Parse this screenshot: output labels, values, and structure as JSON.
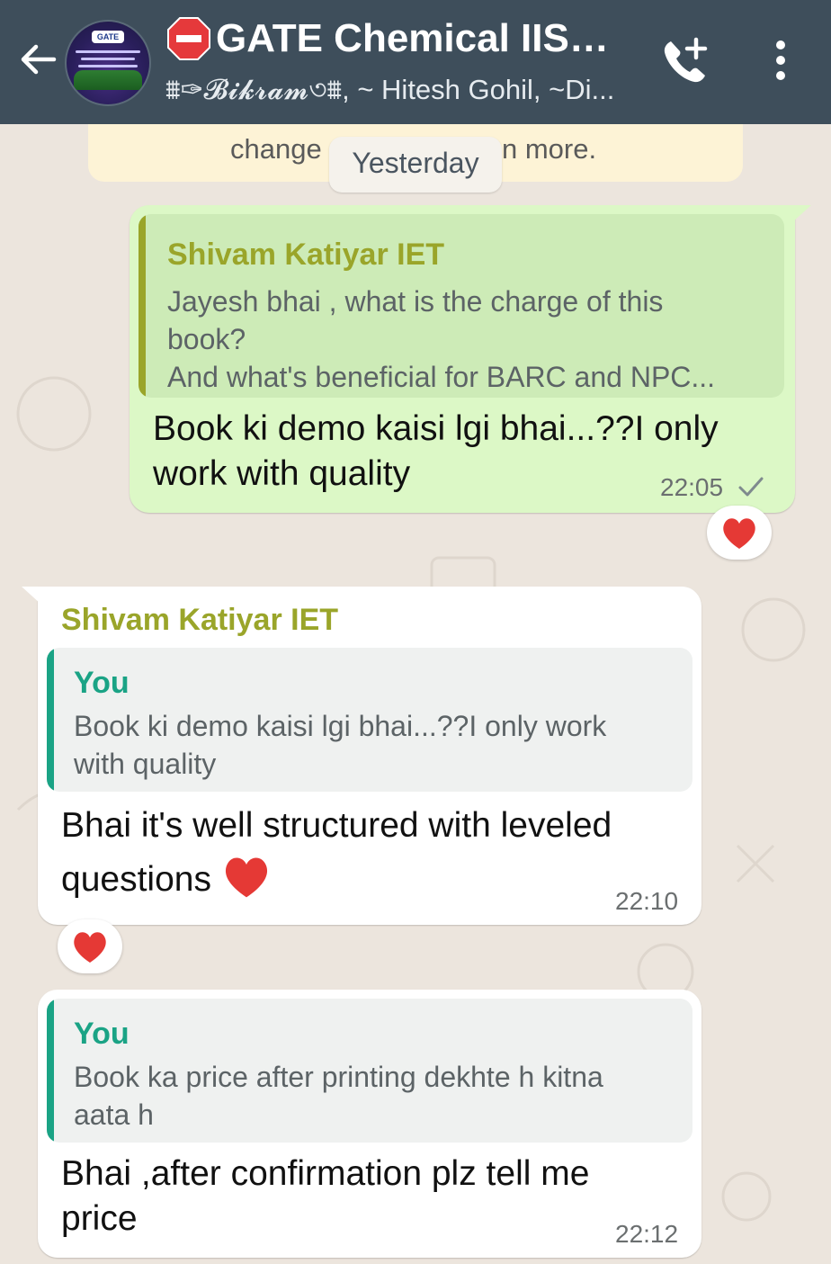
{
  "header": {
    "avatar_badge": "GATE",
    "title": "🛑GATE Chemical IISC...",
    "title_text": "GATE Chemical IISC...",
    "subtitle": "⩩✑𝓑𝓲𝓴𝓻𝓪𝓶৩⩩, ~ Hitesh Gohil, ~Di..."
  },
  "system_banner": {
    "part1": "change",
    "part2": "n more."
  },
  "date_chip": "Yesterday",
  "messages": [
    {
      "direction": "outgoing",
      "quote": {
        "name": "Shivam Katiyar IET",
        "lines": [
          "Jayesh bhai , what is the charge of this",
          "book?",
          "And what's beneficial for BARC and NPC..."
        ]
      },
      "text_lines": [
        "Book ki demo  kaisi lgi bhai...??I only",
        "work with quality"
      ],
      "time": "22:05",
      "reaction": "heart"
    },
    {
      "direction": "incoming",
      "sender": "Shivam Katiyar IET",
      "quote": {
        "name": "You",
        "lines": [
          "Book ki demo  kaisi lgi bhai...??I only work",
          "with quality"
        ]
      },
      "text_lines": [
        "Bhai it's well structured with leveled",
        "questions"
      ],
      "time": "22:10",
      "reaction": "heart"
    },
    {
      "direction": "incoming",
      "quote": {
        "name": "You",
        "lines": [
          "Book ka price after printing dekhte h kitna",
          "aata h"
        ]
      },
      "text_lines": [
        "Bhai ,after confirmation plz tell me",
        "price"
      ],
      "time": "22:12"
    }
  ],
  "colors": {
    "header_bg": "#3E4E5B",
    "chat_bg": "#ECE5DD",
    "outgoing_bubble": "#DCF8C6",
    "incoming_bubble": "#FFFFFF",
    "quote_self": "#1AA385",
    "quote_other": "#9AA52A",
    "heart": "#E53935"
  },
  "icons": [
    "back-arrow-icon",
    "stop-sign-icon",
    "add-call-icon",
    "overflow-menu-icon",
    "check-icon",
    "heart-icon"
  ]
}
